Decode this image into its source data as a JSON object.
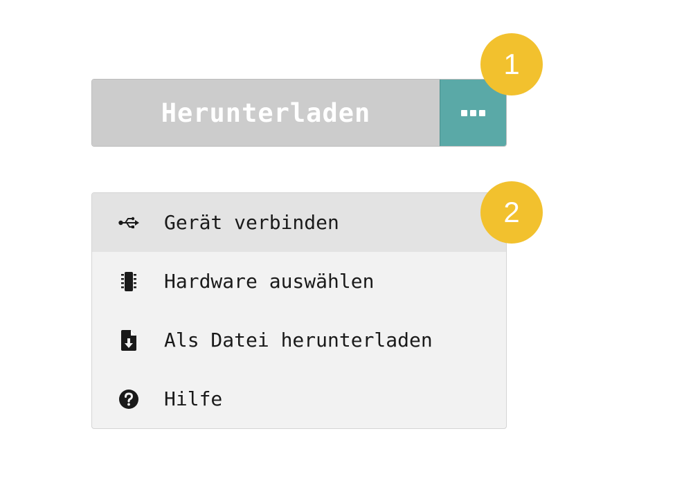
{
  "download": {
    "label": "Herunterladen",
    "more_icon": "ellipsis-icon",
    "accent_color": "#5aa9a7",
    "main_color": "#cccccc"
  },
  "badges": {
    "first": "1",
    "second": "2",
    "color": "#f2c12e"
  },
  "menu": {
    "items": [
      {
        "label": "Gerät verbinden",
        "icon": "usb-icon",
        "highlighted": true
      },
      {
        "label": "Hardware auswählen",
        "icon": "chip-icon",
        "highlighted": false
      },
      {
        "label": "Als Datei herunterladen",
        "icon": "file-download-icon",
        "highlighted": false
      },
      {
        "label": "Hilfe",
        "icon": "help-circle-icon",
        "highlighted": false
      }
    ]
  }
}
